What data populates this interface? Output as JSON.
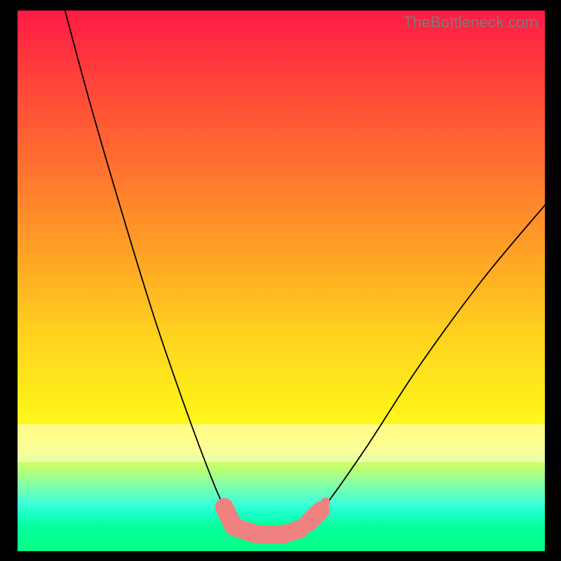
{
  "watermark": "TheBottleneck.com",
  "colors": {
    "accent_segments": "#f08181",
    "curve": "#000000",
    "gradient_top": "#ff1a44",
    "gradient_bottom": "#00ff86"
  },
  "chart_data": {
    "type": "line",
    "title": "",
    "xlabel": "",
    "ylabel": "",
    "xlim": [
      0,
      100
    ],
    "ylim": [
      0,
      100
    ],
    "note": "Axes unlabeled in source image; x and y are normalized 0–100 based on plot-area position. Higher y = higher on screen. Values estimated from pixel positions.",
    "series": [
      {
        "name": "left-branch",
        "x": [
          9,
          14,
          20,
          26,
          32,
          37,
          39.5,
          41
        ],
        "y": [
          100,
          82,
          62,
          43,
          26,
          13,
          7.5,
          4.5
        ]
      },
      {
        "name": "valley-floor",
        "x": [
          41,
          45,
          50,
          54
        ],
        "y": [
          4.5,
          3.2,
          3.0,
          4.2
        ]
      },
      {
        "name": "right-branch",
        "x": [
          54,
          58,
          66,
          76,
          88,
          100
        ],
        "y": [
          4.2,
          8,
          19,
          34,
          50,
          64
        ]
      }
    ],
    "highlighted_segments": [
      {
        "name": "left-sausage",
        "x_range": [
          39.2,
          42.5
        ],
        "shape": "pill"
      },
      {
        "name": "floor-sausage",
        "x_range": [
          43.5,
          53.5
        ],
        "shape": "pill"
      },
      {
        "name": "right-sausage",
        "x_range": [
          55.0,
          57.5
        ],
        "shape": "pill"
      },
      {
        "name": "right-dot",
        "x": 58.4,
        "y": 9.1,
        "shape": "dot"
      }
    ]
  }
}
